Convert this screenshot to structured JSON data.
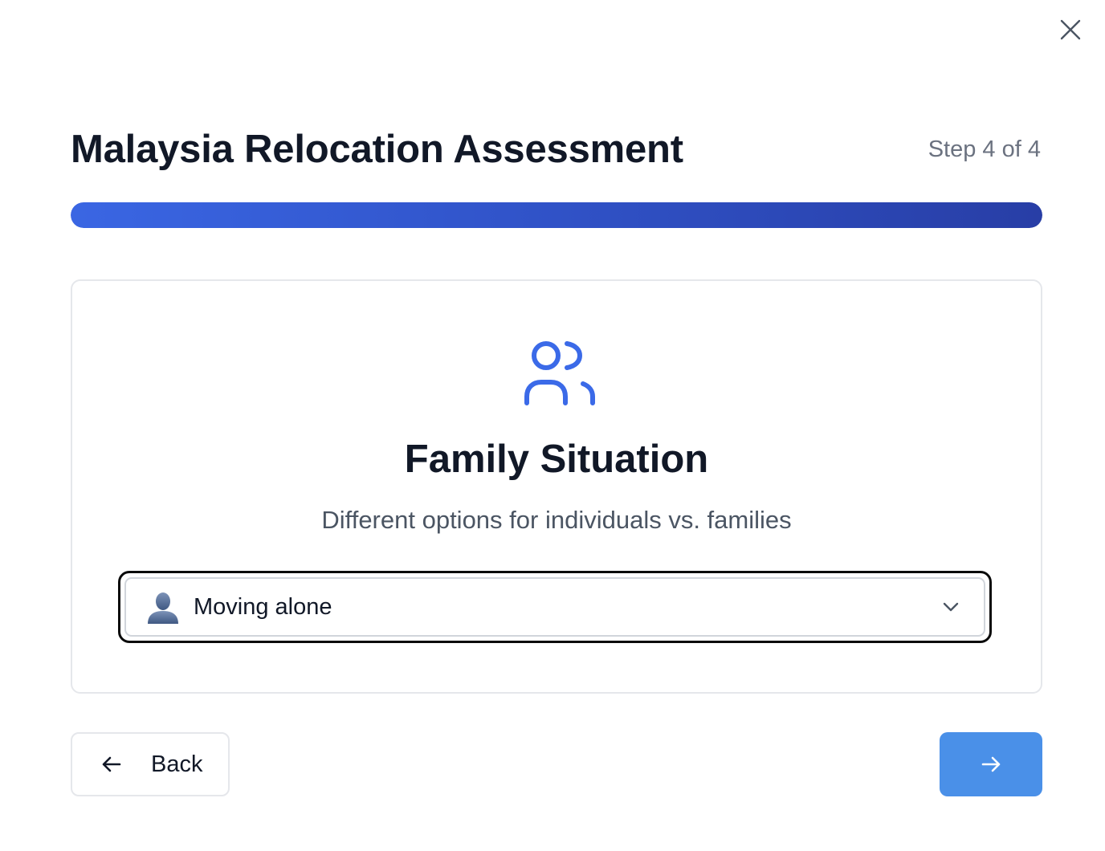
{
  "dialog": {
    "close_icon": "close-icon"
  },
  "header": {
    "title": "Malaysia Relocation Assessment",
    "step_text": "Step 4 of 4"
  },
  "progress": {
    "current_step": 4,
    "total_steps": 4,
    "fraction": 1.0,
    "gradient_start": "#3a66e3",
    "gradient_end": "#283ea6"
  },
  "question": {
    "icon": "users-icon",
    "title": "Family Situation",
    "description": "Different options for individuals vs. families",
    "select": {
      "selected_emoji": "👤",
      "selected_label": "Moving alone",
      "chevron_icon": "chevron-down-icon"
    }
  },
  "navigation": {
    "back_label": "Back",
    "back_icon": "arrow-left-icon",
    "next_icon": "arrow-right-icon",
    "next_color": "#4a90e8"
  },
  "colors": {
    "accent": "#3b6ae8",
    "text_primary": "#111827",
    "text_muted": "#6b7280"
  }
}
